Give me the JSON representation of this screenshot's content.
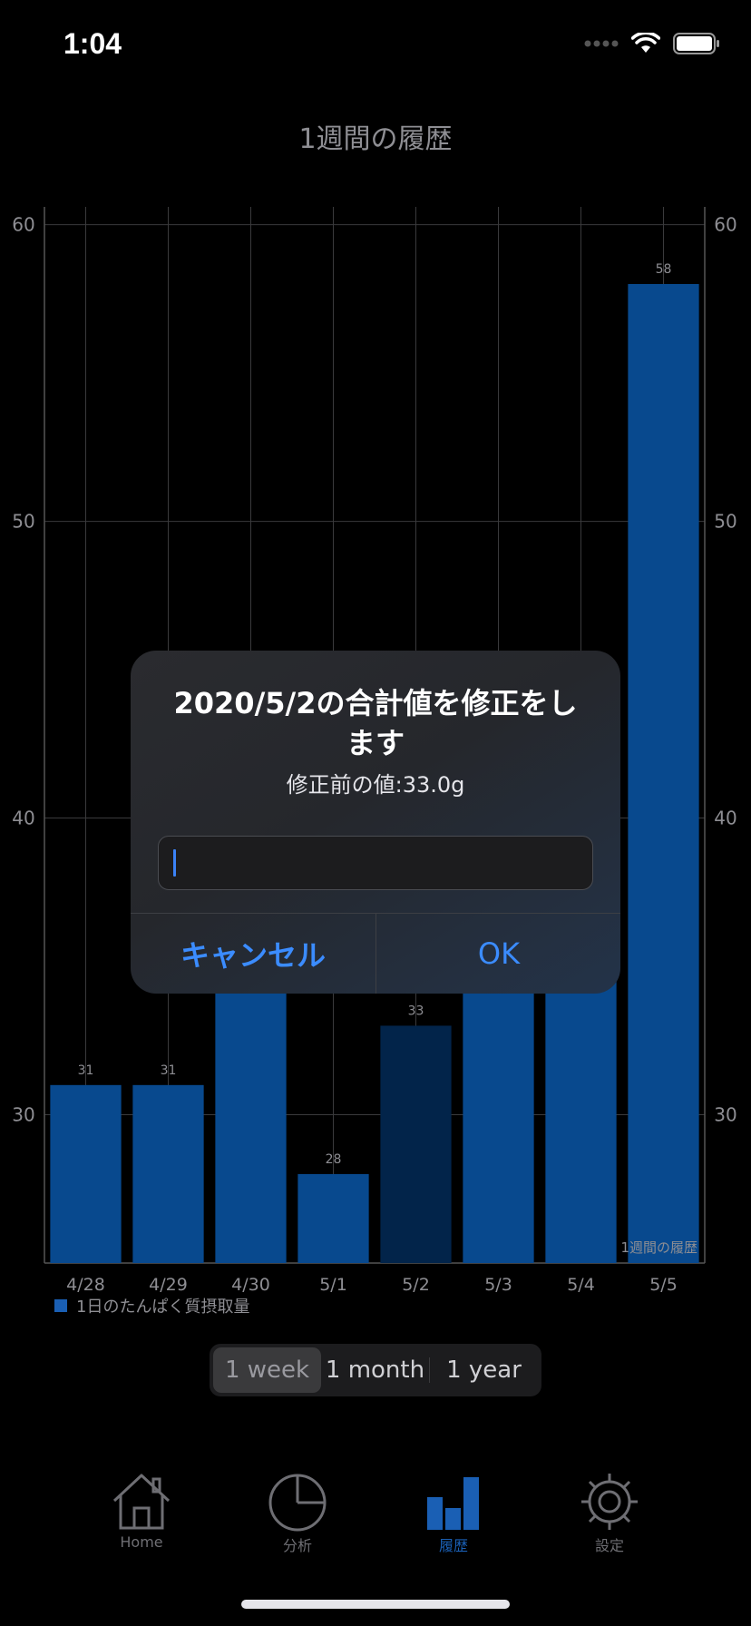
{
  "status_bar": {
    "time": "1:04"
  },
  "header": {
    "title": "1週間の履歴"
  },
  "chart_data": {
    "type": "bar",
    "title": "1週間の履歴",
    "categories": [
      "4/28",
      "4/29",
      "4/30",
      "5/1",
      "5/2",
      "5/3",
      "5/4",
      "5/5"
    ],
    "series": [
      {
        "name": "1日のたんぱく質摂取量",
        "values": [
          31,
          31,
          37,
          28,
          33,
          42,
          42,
          58
        ],
        "data_labels": [
          "31",
          "31",
          "",
          "28",
          "33",
          "",
          "",
          "58"
        ]
      }
    ],
    "ylim": [
      25,
      60.6
    ],
    "yticks": [
      30,
      40,
      50,
      60
    ],
    "highlight_index": 4,
    "grid": true,
    "legend": "bottom-left",
    "corner_label": "1週間の履歴",
    "colors": {
      "bar": "#08498e",
      "highlight": "#02244a",
      "grid": "#3a3a3c",
      "tick": "#8e8e93"
    }
  },
  "legend": {
    "label": "1日のたんぱく質摂取量"
  },
  "segmented": {
    "options": [
      "1 week",
      "1 month",
      "1 year"
    ],
    "selected": "1 week"
  },
  "tabbar": {
    "home": "Home",
    "analysis": "分析",
    "history": "履歴",
    "settings": "設定"
  },
  "alert": {
    "title": "2020/5/2の合計値を修正をします",
    "message": "修正前の値:33.0g",
    "input_value": "",
    "cancel": "キャンセル",
    "ok": "OK"
  },
  "accent_color": "#3b8cff"
}
